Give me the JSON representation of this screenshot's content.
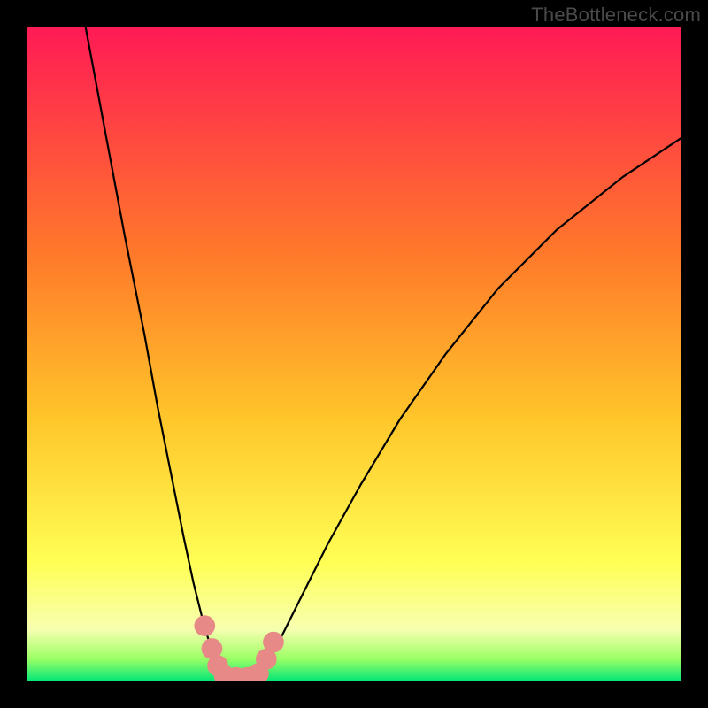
{
  "watermark": "TheBottleneck.com",
  "chart_data": {
    "type": "line",
    "title": "",
    "xlabel": "",
    "ylabel": "",
    "xlim": [
      0,
      100
    ],
    "ylim": [
      0,
      100
    ],
    "background_gradient": [
      {
        "pos": 0.0,
        "color": "#ff1a55"
      },
      {
        "pos": 0.35,
        "color": "#ff7a2a"
      },
      {
        "pos": 0.6,
        "color": "#ffc62a"
      },
      {
        "pos": 0.82,
        "color": "#ffff55"
      },
      {
        "pos": 0.92,
        "color": "#f7ffb0"
      },
      {
        "pos": 0.965,
        "color": "#9dff66"
      },
      {
        "pos": 1.0,
        "color": "#00e676"
      }
    ],
    "series": [
      {
        "name": "bottleneck-curve-left",
        "stroke": "#000000",
        "x": [
          9,
          12,
          15,
          18,
          20,
          22,
          24,
          25.5,
          27,
          28.2,
          29,
          29.8
        ],
        "y": [
          100,
          84,
          68,
          53,
          42,
          32,
          22,
          15,
          9,
          5,
          2.5,
          0.8
        ]
      },
      {
        "name": "bottleneck-curve-right",
        "stroke": "#000000",
        "x": [
          35.5,
          37,
          39,
          42,
          46,
          51,
          57,
          64,
          72,
          81,
          91,
          100
        ],
        "y": [
          0.8,
          3,
          7,
          13,
          21,
          30,
          40,
          50,
          60,
          69,
          77,
          83
        ]
      },
      {
        "name": "valley-floor",
        "stroke": "#000000",
        "x": [
          29.8,
          31,
          33,
          35.5
        ],
        "y": [
          0.8,
          0.4,
          0.4,
          0.8
        ]
      }
    ],
    "markers": [
      {
        "name": "left-marker-1",
        "x": 27.2,
        "y": 8.5,
        "r": 1.6,
        "color": "#e78a87"
      },
      {
        "name": "left-marker-2",
        "x": 28.3,
        "y": 5.0,
        "r": 1.6,
        "color": "#e78a87"
      },
      {
        "name": "left-marker-3",
        "x": 29.2,
        "y": 2.4,
        "r": 1.6,
        "color": "#e78a87"
      },
      {
        "name": "floor-marker-1",
        "x": 30.2,
        "y": 0.9,
        "r": 1.6,
        "color": "#e78a87"
      },
      {
        "name": "floor-marker-2",
        "x": 32.0,
        "y": 0.6,
        "r": 1.6,
        "color": "#e78a87"
      },
      {
        "name": "floor-marker-3",
        "x": 33.8,
        "y": 0.6,
        "r": 1.6,
        "color": "#e78a87"
      },
      {
        "name": "right-marker-1",
        "x": 35.4,
        "y": 1.2,
        "r": 1.6,
        "color": "#e78a87"
      },
      {
        "name": "right-marker-2",
        "x": 36.6,
        "y": 3.4,
        "r": 1.6,
        "color": "#e78a87"
      },
      {
        "name": "right-marker-3",
        "x": 37.7,
        "y": 6.0,
        "r": 1.6,
        "color": "#e78a87"
      }
    ]
  }
}
